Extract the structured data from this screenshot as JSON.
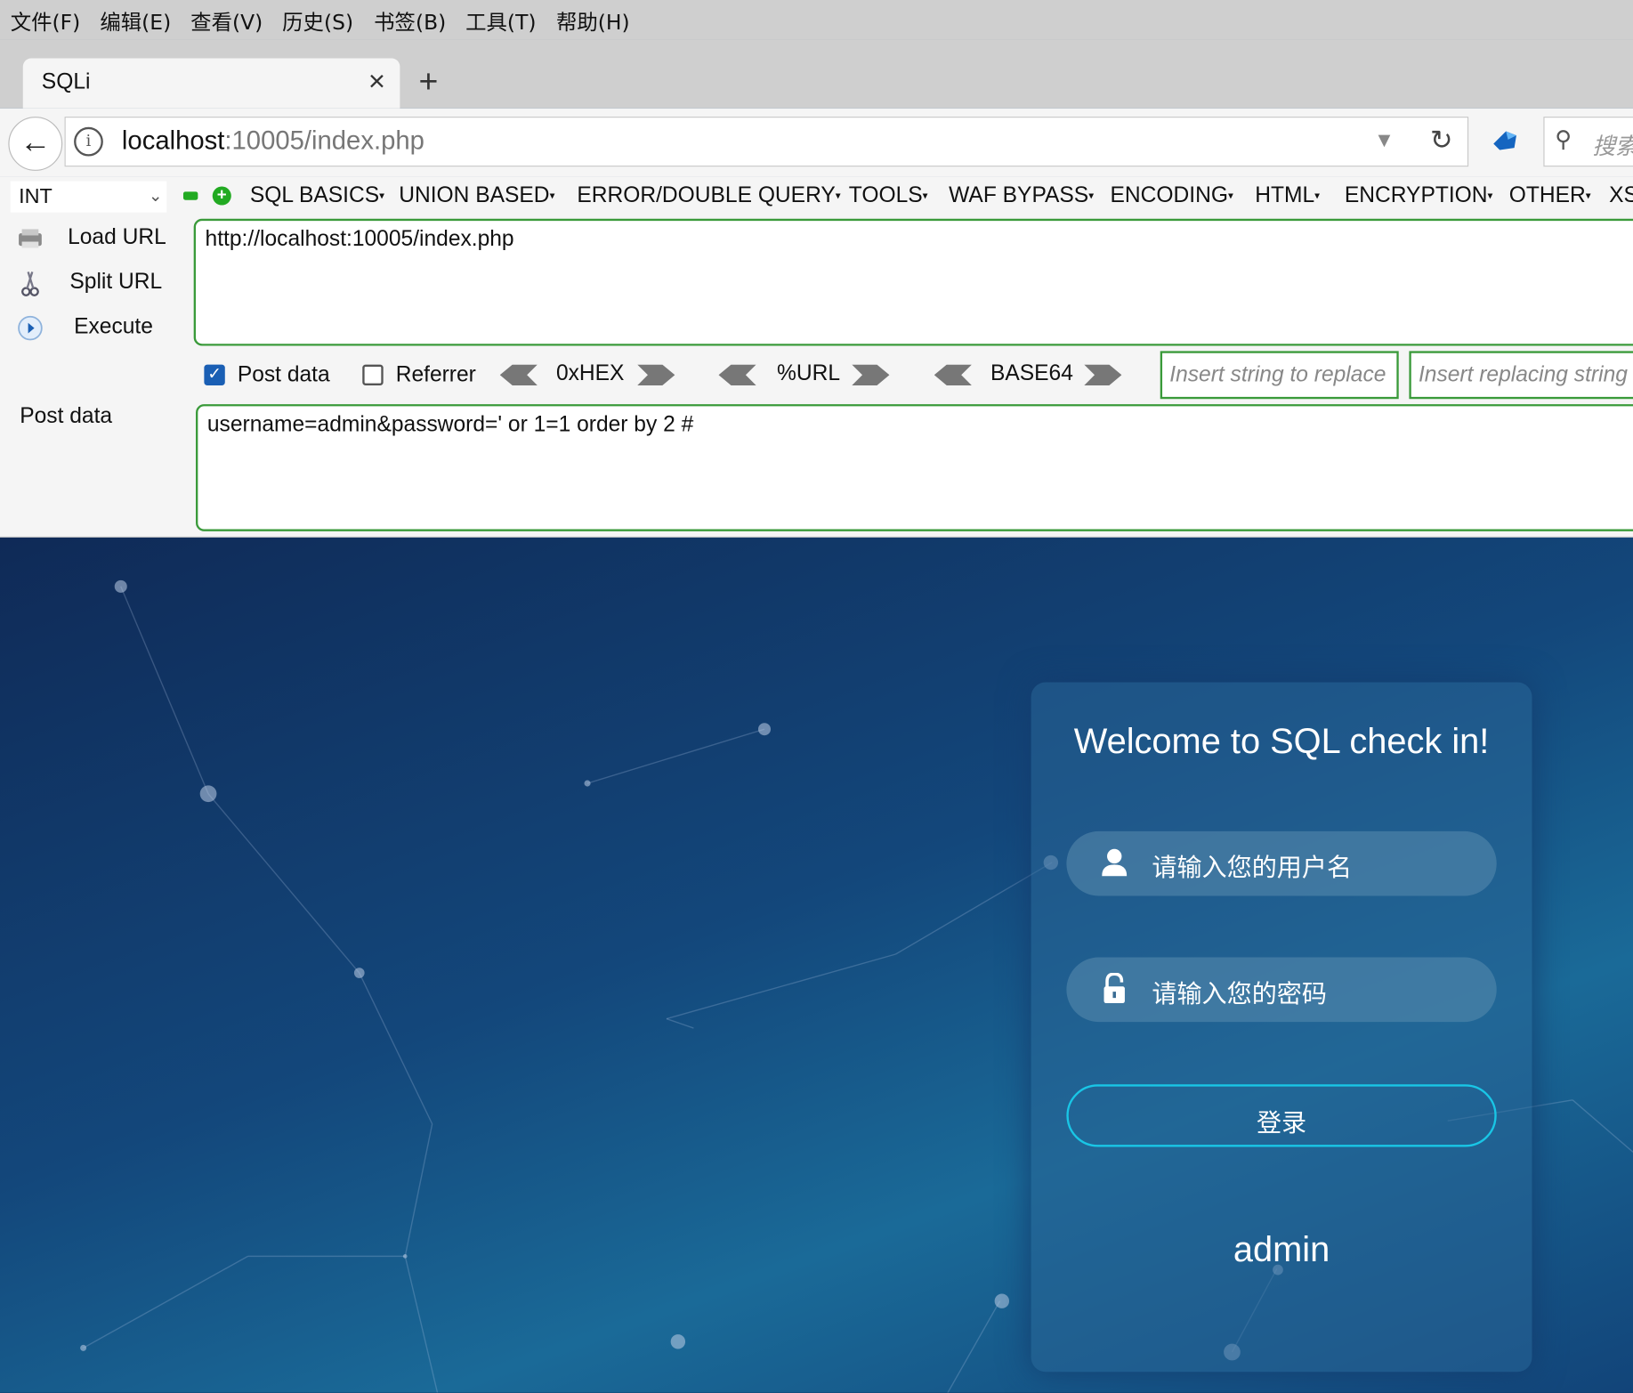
{
  "menubar": {
    "items": [
      "文件(F)",
      "编辑(E)",
      "查看(V)",
      "历史(S)",
      "书签(B)",
      "工具(T)",
      "帮助(H)"
    ]
  },
  "tab": {
    "title": "SQLi",
    "close_glyph": "×",
    "new_tab_glyph": "+"
  },
  "nav": {
    "url_host": "localhost",
    "url_rest": ":10005/index.php",
    "search_placeholder": "搜索"
  },
  "hackbar": {
    "type_select": "INT",
    "menus": [
      "SQL BASICS",
      "UNION BASED",
      "ERROR/DOUBLE QUERY",
      "TOOLS",
      "WAF BYPASS",
      "ENCODING",
      "HTML",
      "ENCRYPTION",
      "OTHER",
      "XSS"
    ],
    "side_buttons": [
      "Load URL",
      "Split URL",
      "Execute"
    ],
    "url_value": "http://localhost:10005/index.php",
    "post_data_checkbox": "Post data",
    "post_data_checked": true,
    "referrer_checkbox": "Referrer",
    "referrer_checked": false,
    "encoders": [
      "0xHEX",
      "%URL",
      "BASE64"
    ],
    "replace_placeholder": "Insert string to replace",
    "replacing_placeholder": "Insert replacing string",
    "post_label": "Post data",
    "post_value": "username=admin&password=' or 1=1 order by 2 #"
  },
  "page": {
    "title": "Welcome to SQL check in!",
    "username_placeholder": "请输入您的用户名",
    "password_placeholder": "请输入您的密码",
    "login_label": "登录",
    "result_text": "admin",
    "accent_color": "#19c6e6"
  }
}
